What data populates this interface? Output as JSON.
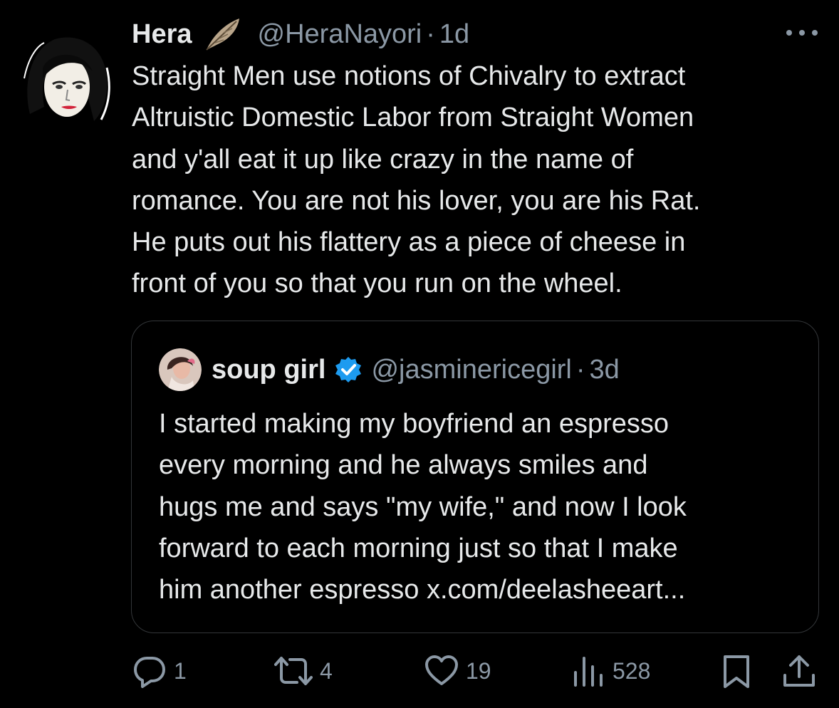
{
  "post": {
    "author_name": "Hera",
    "author_handle": "@HeraNayori",
    "separator": "·",
    "time": "1d",
    "text_lines": [
      "Straight Men use notions of Chivalry to extract",
      "Altruistic Domestic Labor from Straight Women",
      "and y'all eat it up like crazy in the name of",
      "romance. You are not his lover, you are his Rat.",
      "He puts out his flattery as a piece of cheese in",
      "front of you so that you run on the wheel."
    ]
  },
  "quoted": {
    "author_name": "soup girl",
    "author_handle": "@jasminericegirl",
    "separator": "·",
    "time": "3d",
    "text_lines": [
      "I started making my boyfriend an espresso",
      "every morning and he always smiles and",
      "hugs me and says \"my wife,\" and now I look",
      "forward to each morning just so that I make",
      "him another espresso x.com/deelasheeart..."
    ]
  },
  "actions": {
    "replies": "1",
    "reposts": "4",
    "likes": "19",
    "views": "528"
  },
  "colors": {
    "background": "#000000",
    "text": "#e7e9ea",
    "secondary": "#8b98a5",
    "border": "#333639",
    "verified": "#1d9bf0"
  },
  "icons": [
    "more-icon",
    "feather-icon",
    "verified-badge-icon",
    "reply-icon",
    "repost-icon",
    "like-icon",
    "views-icon",
    "bookmark-icon",
    "share-icon"
  ]
}
